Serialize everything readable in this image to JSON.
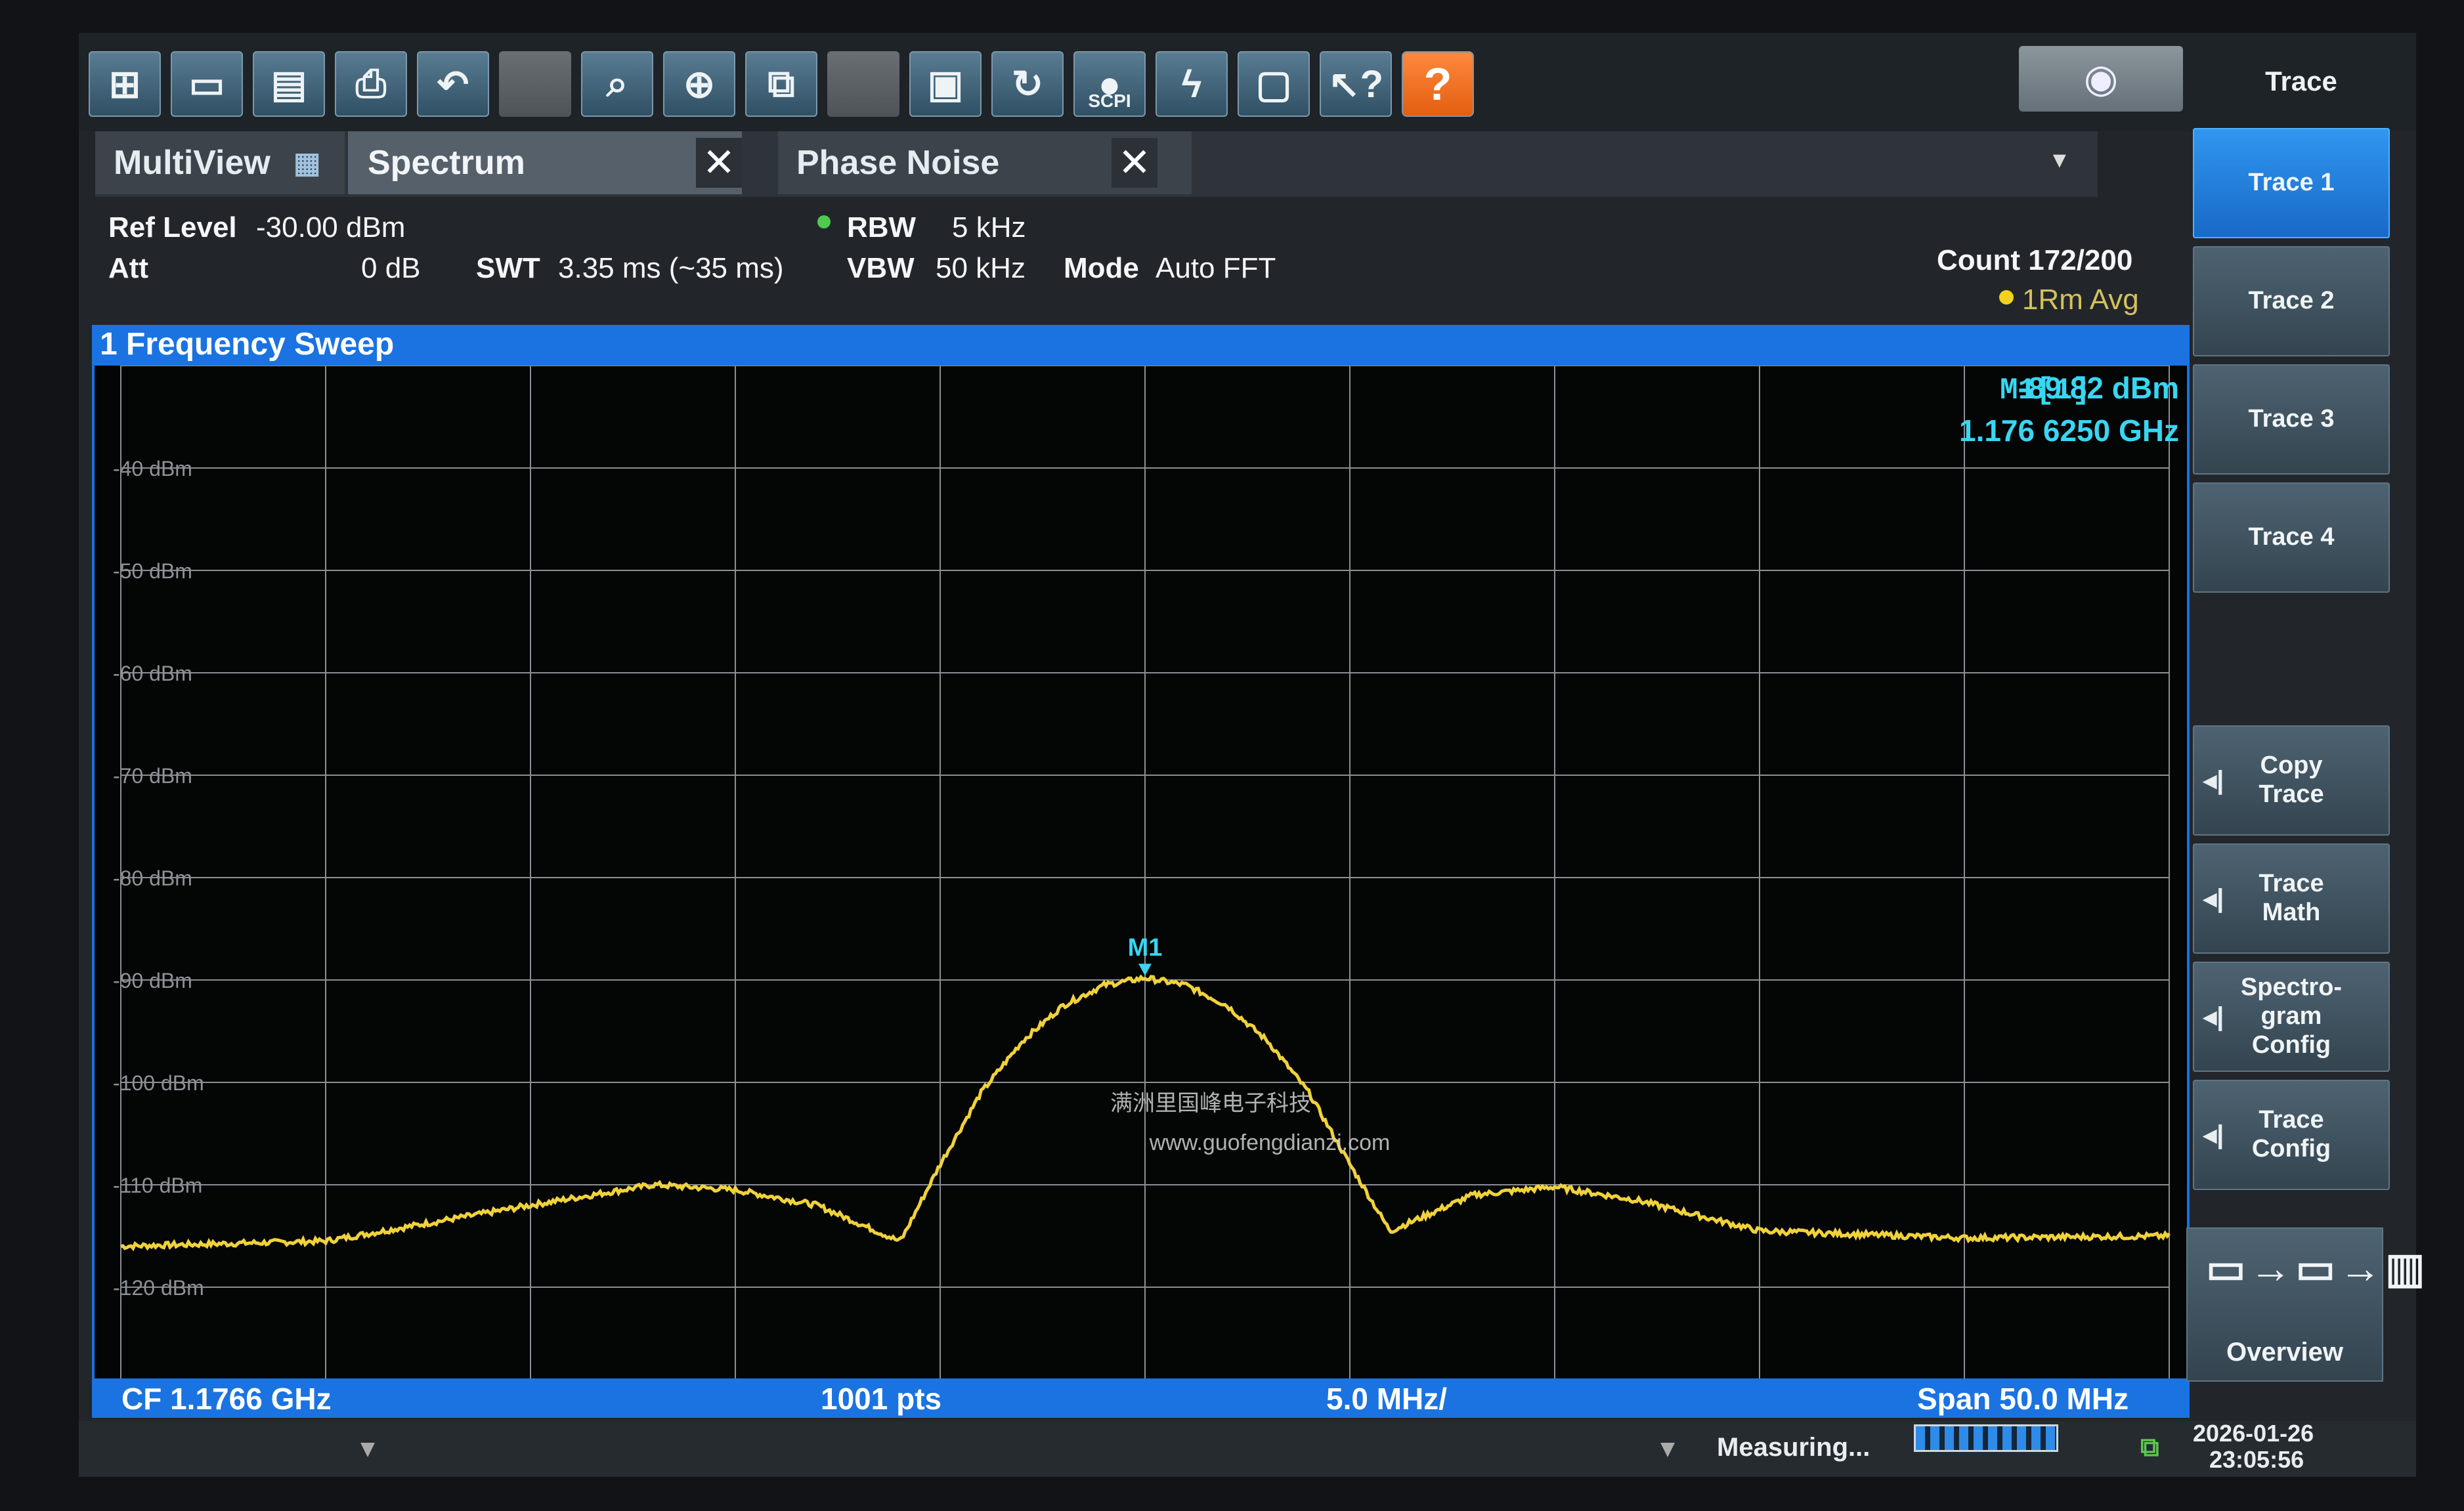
{
  "toolbar": {
    "icons": [
      "windows-icon",
      "open-folder-icon",
      "save-icon",
      "print-icon",
      "undo-icon",
      "blank",
      "zoom-icon",
      "zoom-in-icon",
      "multi-zoom-icon",
      "blank",
      "full-screen-icon",
      "refresh-icon",
      "scpi-icon",
      "sequencer-icon",
      "display-icon",
      "help-pointer-icon",
      "help-icon"
    ],
    "scpi_label": "SCPI"
  },
  "tabs": {
    "multiview": "MultiView",
    "spectrum": "Spectrum",
    "phase_noise": "Phase Noise",
    "close_symbol": "✕"
  },
  "settings": {
    "ref_level_label": "Ref Level",
    "ref_level_value": "-30.00 dBm",
    "att_label": "Att",
    "att_value": "0 dB",
    "swt_label": "SWT",
    "swt_value": "3.35 ms (~35 ms)",
    "rbw_label": "RBW",
    "rbw_value": "5 kHz",
    "vbw_label": "VBW",
    "vbw_value": "50 kHz",
    "mode_label": "Mode",
    "mode_value": "Auto FFT",
    "count": "Count 172/200",
    "trace_mode": "1Rm Avg"
  },
  "window": {
    "title": "1 Frequency Sweep"
  },
  "marker": {
    "name": "M1[1]",
    "level": "-89.82 dBm",
    "frequency": "1.176 6250 GHz",
    "label": "M1"
  },
  "footer": {
    "cf": "CF 1.1766 GHz",
    "points": "1001 pts",
    "div": "5.0 MHz/",
    "span": "Span 50.0 MHz"
  },
  "watermark": {
    "line1": "满洲里国峰电子科技",
    "line2": "www.guofengdianzi.com"
  },
  "status": {
    "measuring": "Measuring...",
    "date": "2026-01-26",
    "time": "23:05:56"
  },
  "side_panel": {
    "title": "Trace",
    "buttons": [
      "Trace 1",
      "Trace 2",
      "Trace 3",
      "Trace 4"
    ],
    "copy_trace": [
      "Copy",
      "Trace"
    ],
    "trace_math": [
      "Trace",
      "Math"
    ],
    "spectrogram": [
      "Spectro-",
      "gram",
      "Config"
    ],
    "trace_config": [
      "Trace",
      "Config"
    ],
    "overview": "Overview"
  },
  "chart_data": {
    "type": "line",
    "y_ticks": [
      "-40 dBm",
      "-50 dBm",
      "-60 dBm",
      "-70 dBm",
      "-80 dBm",
      "-90 dBm",
      "-100 dBm",
      "-110 dBm",
      "-120 dBm"
    ],
    "ylim": [
      -130,
      -30
    ],
    "xlim": [
      -25,
      25
    ],
    "grid": true,
    "trace_color": "#f0d23a",
    "series": [
      {
        "x": [
          -25,
          -20,
          -15,
          -12,
          -10,
          -8,
          -6,
          -5.9,
          -5,
          -4,
          -3,
          -2,
          -1,
          0,
          1,
          2,
          3,
          4,
          5,
          5.9,
          6,
          8,
          10,
          12,
          15,
          20,
          25
        ],
        "y": [
          -116,
          -115.5,
          -112,
          -110,
          -110.5,
          -112,
          -115.5,
          -115,
          -108,
          -101,
          -96,
          -92.5,
          -90.5,
          -89.8,
          -90.5,
          -92.5,
          -96,
          -101,
          -108,
          -114,
          -114.5,
          -111,
          -110.2,
          -111.5,
          -114.5,
          -115.2,
          -115
        ]
      }
    ]
  },
  "colors": {
    "accent": "#1a73e0",
    "trace": "#f0d23a",
    "marker": "#38d6f2"
  }
}
